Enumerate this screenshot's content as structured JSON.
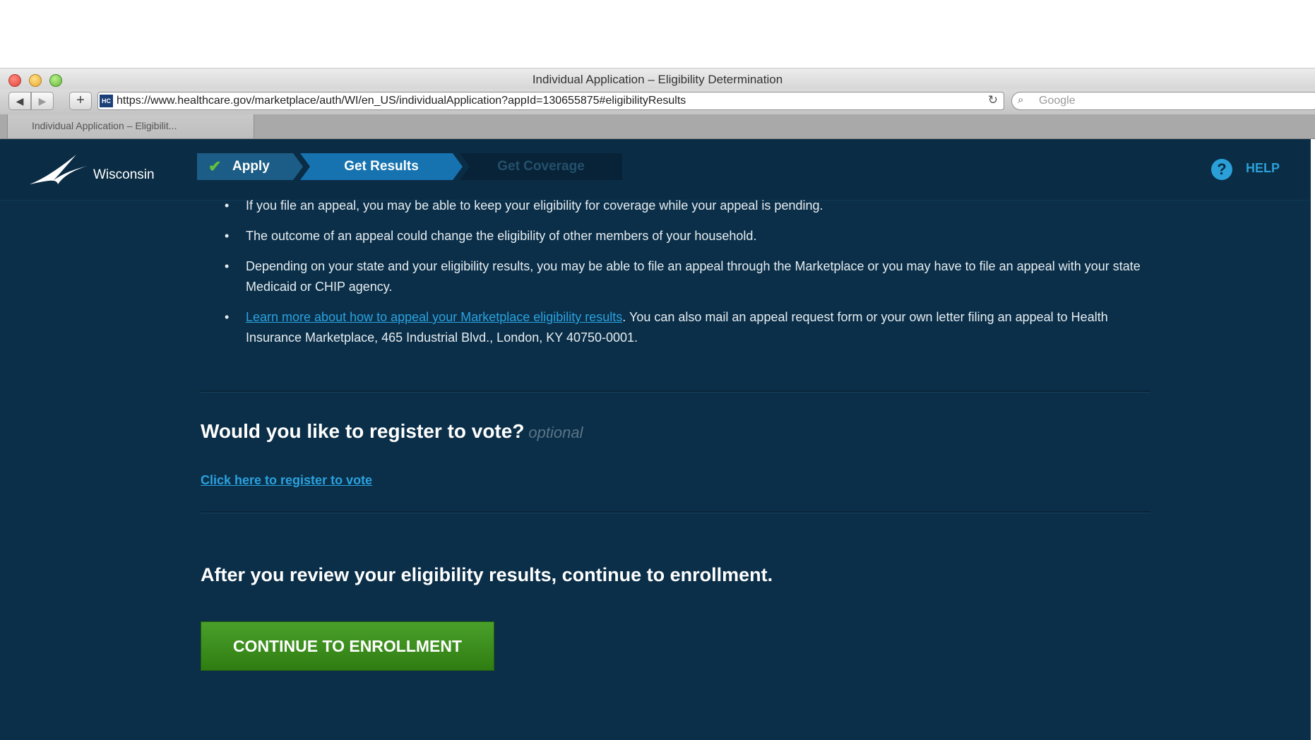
{
  "browser": {
    "window_title": "Individual Application – Eligibility Determination",
    "url": "https://www.healthcare.gov/marketplace/auth/WI/en_US/individualApplication?appId=130655875#eligibilityResults",
    "favicon_text": "HC",
    "search_placeholder": "Google",
    "tab_label": "Individual Application – Eligibilit...",
    "back_icon": "◀",
    "forward_icon": "▶",
    "add_icon": "+",
    "reload_icon": "↻",
    "search_icon": "⌕"
  },
  "header": {
    "state_name": "Wisconsin",
    "steps": [
      {
        "label": "Apply",
        "status": "completed",
        "icon": "✔"
      },
      {
        "label": "Get Results",
        "status": "current"
      },
      {
        "label": "Get Coverage",
        "status": "upcoming"
      }
    ],
    "help_icon": "?",
    "help_label": "HELP"
  },
  "appeal": {
    "bullets": [
      "If you file an appeal, you may be able to keep your eligibility for coverage while your appeal is pending.",
      "The outcome of an appeal could change the eligibility of other members of your household.",
      "Depending on your state and your eligibility results, you may be able to file an appeal through the Marketplace or you may have to file an appeal with your state Medicaid or CHIP agency."
    ],
    "learn_more_link": "Learn more about how to appeal your Marketplace eligibility results",
    "learn_more_text": ". You can also mail an appeal request form or your own letter filing an appeal to Health Insurance Marketplace, 465 Industrial Blvd., London, KY 40750-0001."
  },
  "vote": {
    "heading": "Would you like to register to vote?",
    "optional_label": "optional",
    "link": "Click here to register to vote"
  },
  "enrollment": {
    "heading": "After you review your eligibility results, continue to enrollment.",
    "button": "CONTINUE TO ENROLLMENT"
  },
  "colors": {
    "page_bg": "#0b2f48",
    "link": "#2aa2e0",
    "cta_green": "#3a8f1e",
    "step_current": "#1673b0"
  }
}
